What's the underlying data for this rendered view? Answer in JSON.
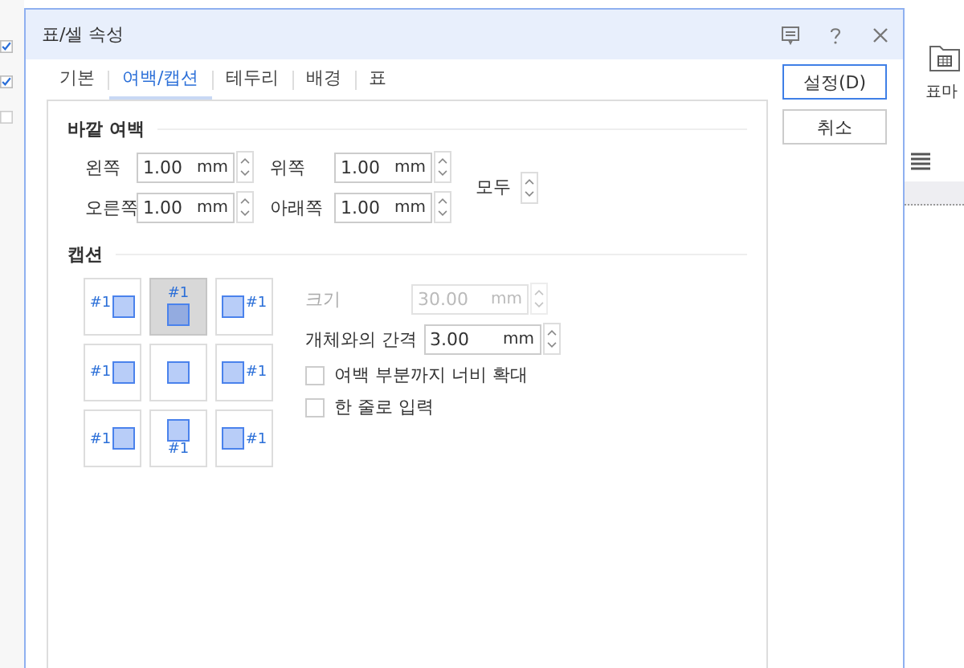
{
  "window": {
    "title": "표/셀 속성"
  },
  "tabs": [
    {
      "label": "기본",
      "selected": false
    },
    {
      "label": "여백/캡션",
      "selected": true
    },
    {
      "label": "테두리",
      "selected": false
    },
    {
      "label": "배경",
      "selected": false
    },
    {
      "label": "표",
      "selected": false
    }
  ],
  "outer_margin": {
    "heading": "바깥 여백",
    "fields": [
      {
        "label": "왼쪽",
        "value": "1.00",
        "unit": "mm"
      },
      {
        "label": "위쪽",
        "value": "1.00",
        "unit": "mm"
      },
      {
        "label": "오른쪽",
        "value": "1.00",
        "unit": "mm"
      },
      {
        "label": "아래쪽",
        "value": "1.00",
        "unit": "mm"
      }
    ],
    "all_label": "모두"
  },
  "caption": {
    "heading": "캡션",
    "positions": [
      {
        "kind": "left-top",
        "caption": "#1",
        "selected": false
      },
      {
        "kind": "top",
        "caption": "#1",
        "selected": true
      },
      {
        "kind": "right-top",
        "caption": "#1",
        "selected": false
      },
      {
        "kind": "left",
        "caption": "#1",
        "selected": false
      },
      {
        "kind": "none",
        "selected": false
      },
      {
        "kind": "right",
        "caption": "#1",
        "selected": false
      },
      {
        "kind": "left-bottom",
        "caption": "#1",
        "selected": false
      },
      {
        "kind": "bottom",
        "caption": "#1",
        "selected": false
      },
      {
        "kind": "right-bottom",
        "caption": "#1",
        "selected": false
      }
    ],
    "size": {
      "label": "크기",
      "value": "30.00",
      "unit": "mm",
      "disabled": true
    },
    "gap": {
      "label": "개체와의 간격",
      "value": "3.00",
      "unit": "mm",
      "disabled": false
    },
    "options": [
      {
        "label": "여백 부분까지 너비 확대",
        "checked": false
      },
      {
        "label": "한 줄로 입력",
        "checked": false
      }
    ]
  },
  "buttons": [
    {
      "label": "설정(D)",
      "default": true
    },
    {
      "label": "취소",
      "default": false
    }
  ],
  "background": {
    "ribbon_label": "표마"
  }
}
